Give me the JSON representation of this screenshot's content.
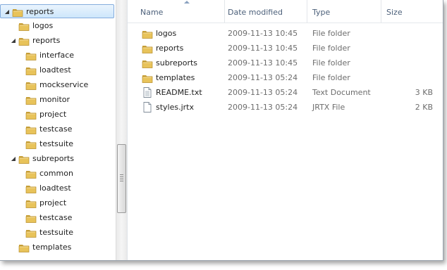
{
  "tree": {
    "items": [
      {
        "label": "reports",
        "expanded": true,
        "selected": true
      },
      {
        "label": "logos",
        "expanded": false
      },
      {
        "label": "reports",
        "expanded": true
      },
      {
        "label": "interface",
        "expanded": false
      },
      {
        "label": "loadtest",
        "expanded": false
      },
      {
        "label": "mockservice",
        "expanded": false
      },
      {
        "label": "monitor",
        "expanded": false
      },
      {
        "label": "project",
        "expanded": false
      },
      {
        "label": "testcase",
        "expanded": false
      },
      {
        "label": "testsuite",
        "expanded": false
      },
      {
        "label": "subreports",
        "expanded": true
      },
      {
        "label": "common",
        "expanded": false
      },
      {
        "label": "loadtest",
        "expanded": false
      },
      {
        "label": "project",
        "expanded": false
      },
      {
        "label": "testcase",
        "expanded": false
      },
      {
        "label": "testsuite",
        "expanded": false
      },
      {
        "label": "templates",
        "expanded": false
      }
    ]
  },
  "columns": {
    "name": "Name",
    "date_modified": "Date modified",
    "type": "Type",
    "size": "Size"
  },
  "files": [
    {
      "name": "logos",
      "date": "2009-11-13 10:45",
      "type": "File folder",
      "size": "",
      "icon": "folder-icon"
    },
    {
      "name": "reports",
      "date": "2009-11-13 10:45",
      "type": "File folder",
      "size": "",
      "icon": "folder-icon"
    },
    {
      "name": "subreports",
      "date": "2009-11-13 10:45",
      "type": "File folder",
      "size": "",
      "icon": "folder-icon"
    },
    {
      "name": "templates",
      "date": "2009-11-13 05:24",
      "type": "File folder",
      "size": "",
      "icon": "folder-icon"
    },
    {
      "name": "README.txt",
      "date": "2009-11-13 05:24",
      "type": "Text Document",
      "size": "3 KB",
      "icon": "text-document-icon"
    },
    {
      "name": "styles.jrtx",
      "date": "2009-11-13 05:24",
      "type": "JRTX File",
      "size": "2 KB",
      "icon": "file-icon"
    }
  ],
  "colors": {
    "selection_border": "#84acdd",
    "header_text": "#4c607a",
    "folder": "#e8c35a"
  }
}
